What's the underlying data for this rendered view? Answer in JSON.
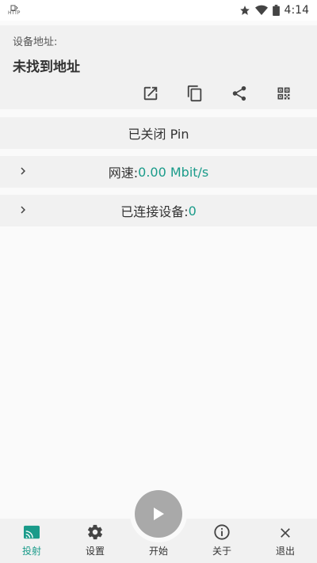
{
  "status_bar": {
    "http_label": "HTTP",
    "time": "4:14"
  },
  "address_card": {
    "label": "设备地址:",
    "value": "未找到地址",
    "actions": [
      "open-external-icon",
      "copy-icon",
      "share-icon",
      "qr-code-icon"
    ]
  },
  "pin_row": {
    "text": "已关闭 Pin"
  },
  "speed_row": {
    "label": "网速: ",
    "value": "0.00 Mbit/s"
  },
  "devices_row": {
    "label": "已连接设备: ",
    "value": "0"
  },
  "bottom_nav": {
    "cast": "投射",
    "settings": "设置",
    "start": "开始",
    "about": "关于",
    "exit": "退出"
  },
  "colors": {
    "accent": "#1a9b8a",
    "card": "#f1f1f1",
    "fab": "#a9a9a9"
  }
}
